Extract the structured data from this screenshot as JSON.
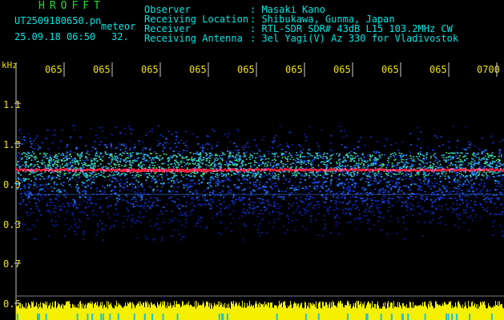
{
  "header": {
    "title": "HROFFT",
    "filename": "UT2509180650.pn",
    "mode": "meteor",
    "datetime": "25.09.18 06:50",
    "count": "32.",
    "labels": [
      "Observer",
      "Receiving Location",
      "Receiver",
      "Receiving Antenna"
    ],
    "values": [
      ": Masaki Kano",
      ": Shibukawa, Gunma, Japan",
      ": RTL-SDR SDR# 43dB L15 103.2MHz CW",
      ": 3el Yagi(V) Az 330 for Vladivostok"
    ]
  },
  "axis": {
    "y_unit": "kHz",
    "y_ticks": [
      "1.1",
      "1.0",
      "0.9",
      "0.8",
      "0.7",
      "0.6"
    ],
    "x_ticks": [
      "065",
      "065",
      "065",
      "065",
      "065",
      "065",
      "065",
      "065",
      "065",
      "0700"
    ]
  },
  "colors": {
    "label": "#00e6e6",
    "title": "#20e020",
    "time": "#f0e000",
    "background": "#000000"
  }
}
